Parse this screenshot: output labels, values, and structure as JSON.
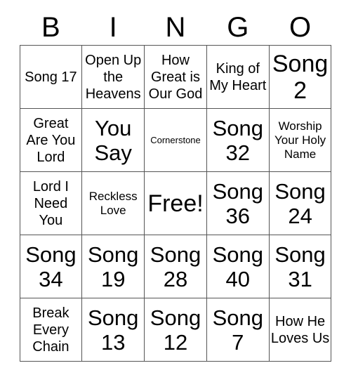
{
  "card": {
    "title": "BINGO",
    "header_letters": [
      "B",
      "I",
      "N",
      "G",
      "O"
    ],
    "columns": 5,
    "rows": 5,
    "free_space": "Free!",
    "border_color": "#555555",
    "text_color": "#000000",
    "background_color": "#ffffff",
    "cells": [
      [
        {
          "text": "Song 17",
          "size": "sz-md"
        },
        {
          "text": "Open Up the Heavens",
          "size": "sz-md"
        },
        {
          "text": "How Great is Our God",
          "size": "sz-md"
        },
        {
          "text": "King of My Heart",
          "size": "sz-md"
        },
        {
          "text": "Song 2",
          "size": "sz-xxl"
        }
      ],
      [
        {
          "text": "Great Are You Lord",
          "size": "sz-md"
        },
        {
          "text": "You Say",
          "size": "sz-xl"
        },
        {
          "text": "Cornerstone",
          "size": "sz-xs"
        },
        {
          "text": "Song 32",
          "size": "sz-xl"
        },
        {
          "text": "Worship Your Holy Name",
          "size": "sz-sm"
        }
      ],
      [
        {
          "text": "Lord I Need You",
          "size": "sz-md"
        },
        {
          "text": "Reckless Love",
          "size": "sz-sm"
        },
        {
          "text": "Free!",
          "size": "sz-xxl"
        },
        {
          "text": "Song 36",
          "size": "sz-xl"
        },
        {
          "text": "Song 24",
          "size": "sz-xl"
        }
      ],
      [
        {
          "text": "Song 34",
          "size": "sz-xl"
        },
        {
          "text": "Song 19",
          "size": "sz-xl"
        },
        {
          "text": "Song 28",
          "size": "sz-xl"
        },
        {
          "text": "Song 40",
          "size": "sz-xl"
        },
        {
          "text": "Song 31",
          "size": "sz-xl"
        }
      ],
      [
        {
          "text": "Break Every Chain",
          "size": "sz-md"
        },
        {
          "text": "Song 13",
          "size": "sz-xl"
        },
        {
          "text": "Song 12",
          "size": "sz-xl"
        },
        {
          "text": "Song 7",
          "size": "sz-xl"
        },
        {
          "text": "How He Loves Us",
          "size": "sz-md"
        }
      ]
    ]
  }
}
